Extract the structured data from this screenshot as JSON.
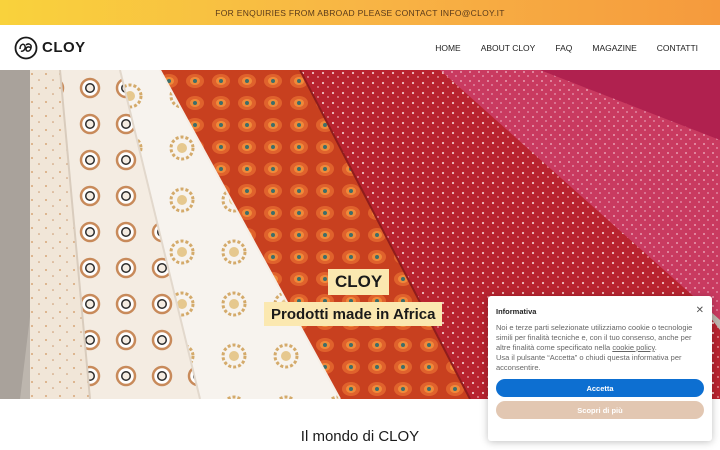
{
  "topbar": {
    "text": "FOR ENQUIRIES FROM ABROAD PLEASE CONTACT INFO@CLOY.IT"
  },
  "header": {
    "logo_text": "CLOY",
    "nav": [
      "HOME",
      "ABOUT CLOY",
      "FAQ",
      "MAGAZINE",
      "CONTATTI"
    ]
  },
  "hero": {
    "title": "CLOY",
    "subtitle": "Prodotti made in Africa"
  },
  "section": {
    "title": "Il mondo di CLOY"
  },
  "cookie": {
    "title": "Informativa",
    "close_icon": "close-icon",
    "text_before_link": "Noi e terze parti selezionate utilizziamo cookie o tecnologie simili per finalità tecniche e, con il tuo consenso, anche per altre finalità come specificato nella ",
    "link_text": "cookie policy",
    "text_after_link": ".",
    "text2": "Usa il pulsante “Accetta” o chiudi questa informativa per acconsentire.",
    "accept_label": "Accetta",
    "more_label": "Scopri di più"
  },
  "colors": {
    "topbar_start": "#f9d23c",
    "topbar_end": "#f59a3d",
    "accept_button": "#0d6fd1",
    "more_button": "#e2c7b2",
    "label_bg": "#fbe8b0"
  }
}
